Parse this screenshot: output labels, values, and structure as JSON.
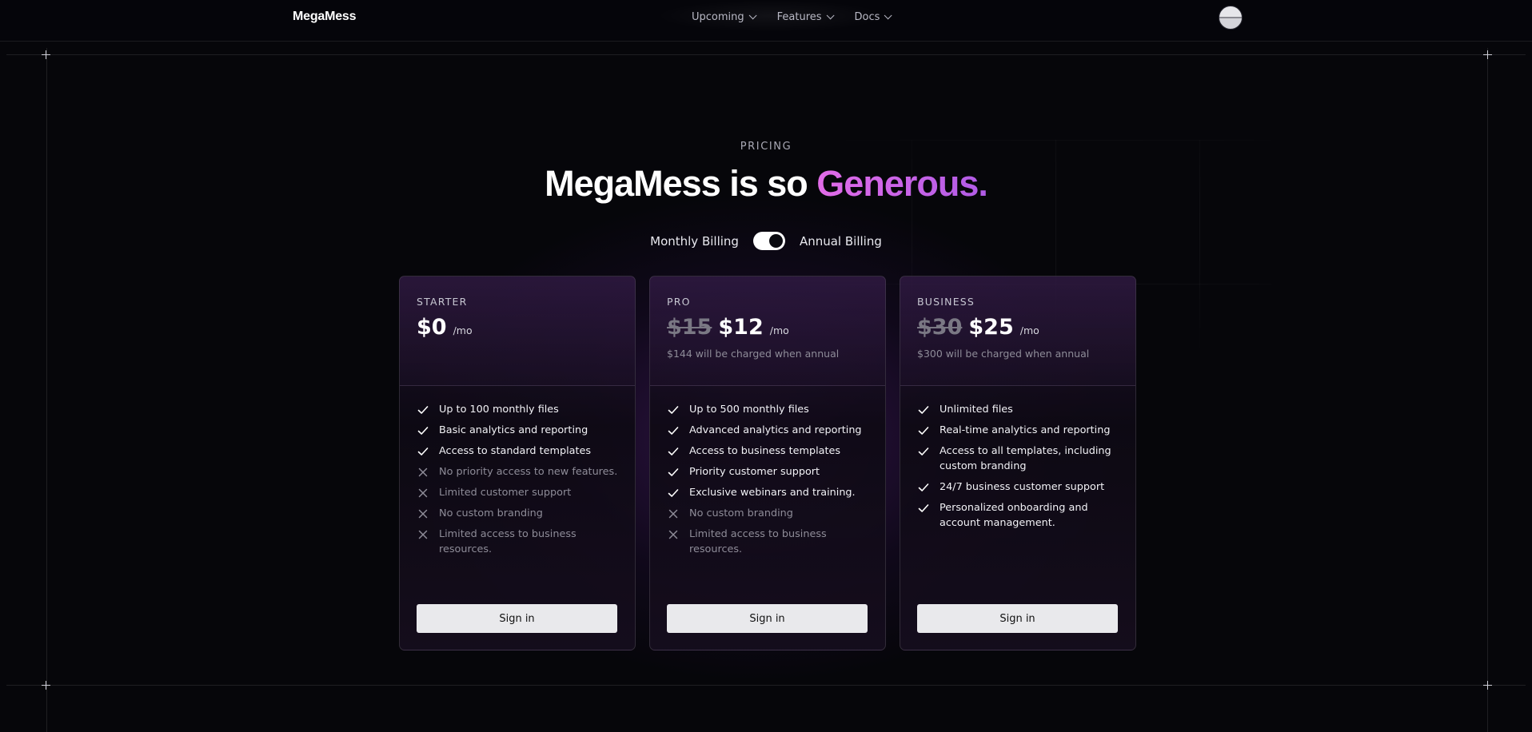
{
  "nav": {
    "logo": "MegaMess",
    "items": [
      {
        "label": "Upcoming"
      },
      {
        "label": "Features"
      },
      {
        "label": "Docs"
      }
    ]
  },
  "hero": {
    "eyebrow": "PRICING",
    "heading_main": "MegaMess is so ",
    "heading_accent": "Generous."
  },
  "billing": {
    "monthly_label": "Monthly Billing",
    "annual_label": "Annual Billing",
    "annual_selected": true
  },
  "plans": [
    {
      "tier": "STARTER",
      "old_price": "",
      "price": "$0",
      "per": "/mo",
      "note": "",
      "features": [
        {
          "text": "Up to 100 monthly files",
          "included": true
        },
        {
          "text": "Basic analytics and reporting",
          "included": true
        },
        {
          "text": "Access to standard templates",
          "included": true
        },
        {
          "text": "No priority access to new features.",
          "included": false
        },
        {
          "text": "Limited customer support",
          "included": false
        },
        {
          "text": "No custom branding",
          "included": false
        },
        {
          "text": "Limited access to business resources.",
          "included": false
        }
      ],
      "cta": "Sign in"
    },
    {
      "tier": "PRO",
      "old_price": "$15",
      "price": "$12",
      "per": "/mo",
      "note": "$144 will be charged when annual",
      "features": [
        {
          "text": "Up to 500 monthly files",
          "included": true
        },
        {
          "text": "Advanced analytics and reporting",
          "included": true
        },
        {
          "text": "Access to business templates",
          "included": true
        },
        {
          "text": "Priority customer support",
          "included": true
        },
        {
          "text": "Exclusive webinars and training.",
          "included": true
        },
        {
          "text": "No custom branding",
          "included": false
        },
        {
          "text": "Limited access to business resources.",
          "included": false
        }
      ],
      "cta": "Sign in"
    },
    {
      "tier": "BUSINESS",
      "old_price": "$30",
      "price": "$25",
      "per": "/mo",
      "note": "$300 will be charged when annual",
      "features": [
        {
          "text": "Unlimited files",
          "included": true
        },
        {
          "text": "Real-time analytics and reporting",
          "included": true
        },
        {
          "text": "Access to all templates, including custom branding",
          "included": true
        },
        {
          "text": "24/7 business customer support",
          "included": true
        },
        {
          "text": "Personalized onboarding and account management.",
          "included": true
        }
      ],
      "cta": "Sign in"
    }
  ],
  "colors": {
    "background": "#06060a",
    "accent_gradient_start": "#e26ce8",
    "accent_gradient_end": "#b05be6",
    "button_bg": "#e9e9ec"
  },
  "icons": {
    "included": "check-icon",
    "excluded": "x-icon"
  }
}
